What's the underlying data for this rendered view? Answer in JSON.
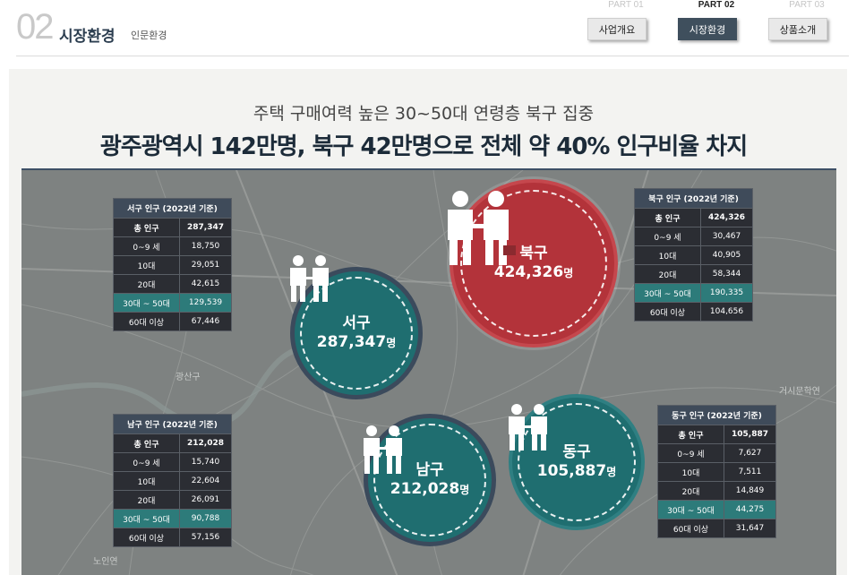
{
  "header": {
    "section_number": "02",
    "section_title": "시장환경",
    "section_subtitle": "인문환경",
    "parts": [
      {
        "part": "PART 01",
        "label": "사업개요",
        "active": false
      },
      {
        "part": "PART 02",
        "label": "시장환경",
        "active": true
      },
      {
        "part": "PART 03",
        "label": "상품소개",
        "active": false
      }
    ]
  },
  "headline": {
    "sub": "주택 구매여력 높은 30~50대 연령층 북구 집중",
    "main": "광주광역시 142만명, 북구 42만명으로 전체 약 40% 인구비율 차지"
  },
  "map": {
    "labels": [
      "광산구",
      "거시문학연",
      "노인연"
    ],
    "colors": {
      "teal": "#1f6e70",
      "red": "#b3333a",
      "table_dark": "#2b2d33",
      "table_highlight": "#2d7b7a"
    }
  },
  "districts": {
    "seo": {
      "name": "서구",
      "pop": "287,347",
      "unit": "명"
    },
    "buk": {
      "name": "북구",
      "pop": "424,326",
      "unit": "명"
    },
    "nam": {
      "name": "남구",
      "pop": "212,028",
      "unit": "명"
    },
    "dong": {
      "name": "동구",
      "pop": "105,887",
      "unit": "명"
    }
  },
  "tables": {
    "seo": {
      "title": "서구 인구 (2022년 기준)",
      "rows": [
        {
          "k": "총 인구",
          "v": "287,347"
        },
        {
          "k": "0~9 세",
          "v": "18,750"
        },
        {
          "k": "10대",
          "v": "29,051"
        },
        {
          "k": "20대",
          "v": "42,615"
        },
        {
          "k": "30대 ~ 50대",
          "v": "129,539"
        },
        {
          "k": "60대 이상",
          "v": "67,446"
        }
      ]
    },
    "buk": {
      "title": "북구 인구 (2022년 기준)",
      "rows": [
        {
          "k": "총 인구",
          "v": "424,326"
        },
        {
          "k": "0~9 세",
          "v": "30,467"
        },
        {
          "k": "10대",
          "v": "40,905"
        },
        {
          "k": "20대",
          "v": "58,344"
        },
        {
          "k": "30대 ~ 50대",
          "v": "190,335"
        },
        {
          "k": "60대 이상",
          "v": "104,656"
        }
      ]
    },
    "nam": {
      "title": "남구 인구 (2022년 기준)",
      "rows": [
        {
          "k": "총 인구",
          "v": "212,028"
        },
        {
          "k": "0~9 세",
          "v": "15,740"
        },
        {
          "k": "10대",
          "v": "22,604"
        },
        {
          "k": "20대",
          "v": "26,091"
        },
        {
          "k": "30대 ~ 50대",
          "v": "90,788"
        },
        {
          "k": "60대 이상",
          "v": "57,156"
        }
      ]
    },
    "dong": {
      "title": "동구 인구 (2022년 기준)",
      "rows": [
        {
          "k": "총 인구",
          "v": "105,887"
        },
        {
          "k": "0~9 세",
          "v": "7,627"
        },
        {
          "k": "10대",
          "v": "7,511"
        },
        {
          "k": "20대",
          "v": "14,849"
        },
        {
          "k": "30대 ~ 50대",
          "v": "44,275"
        },
        {
          "k": "60대 이상",
          "v": "31,647"
        }
      ]
    }
  }
}
